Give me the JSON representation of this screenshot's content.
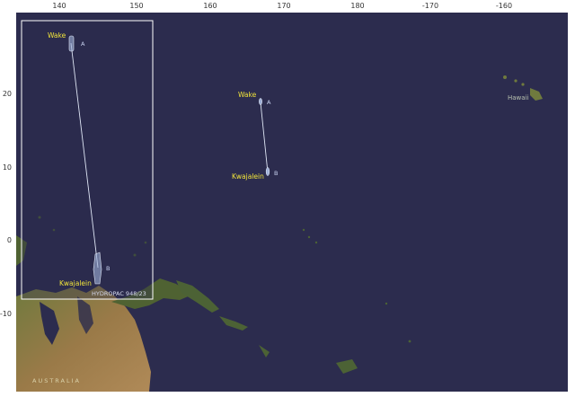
{
  "axes": {
    "top_ticks": [
      "140",
      "150",
      "160",
      "170",
      "180",
      "-170",
      "-160"
    ],
    "left_ticks": [
      "20",
      "10",
      "0",
      "-10"
    ]
  },
  "main_map": {
    "route_start_label": "Wake",
    "route_end_label": "Kwajalein",
    "point_a": "A",
    "point_b": "B",
    "region_label": "Hawaii",
    "country_label": "AUSTRALIA"
  },
  "inset": {
    "route_start_label": "Wake",
    "route_end_label": "Kwajalein",
    "point_a": "A",
    "point_b": "B",
    "reference": "HYDROPAC 948/23"
  },
  "colors": {
    "ocean": "#2c2c4e",
    "land": "#5a6b3a",
    "label": "#f2e53a",
    "route": "#dfe6f5",
    "inset_border": "#ffffff"
  }
}
